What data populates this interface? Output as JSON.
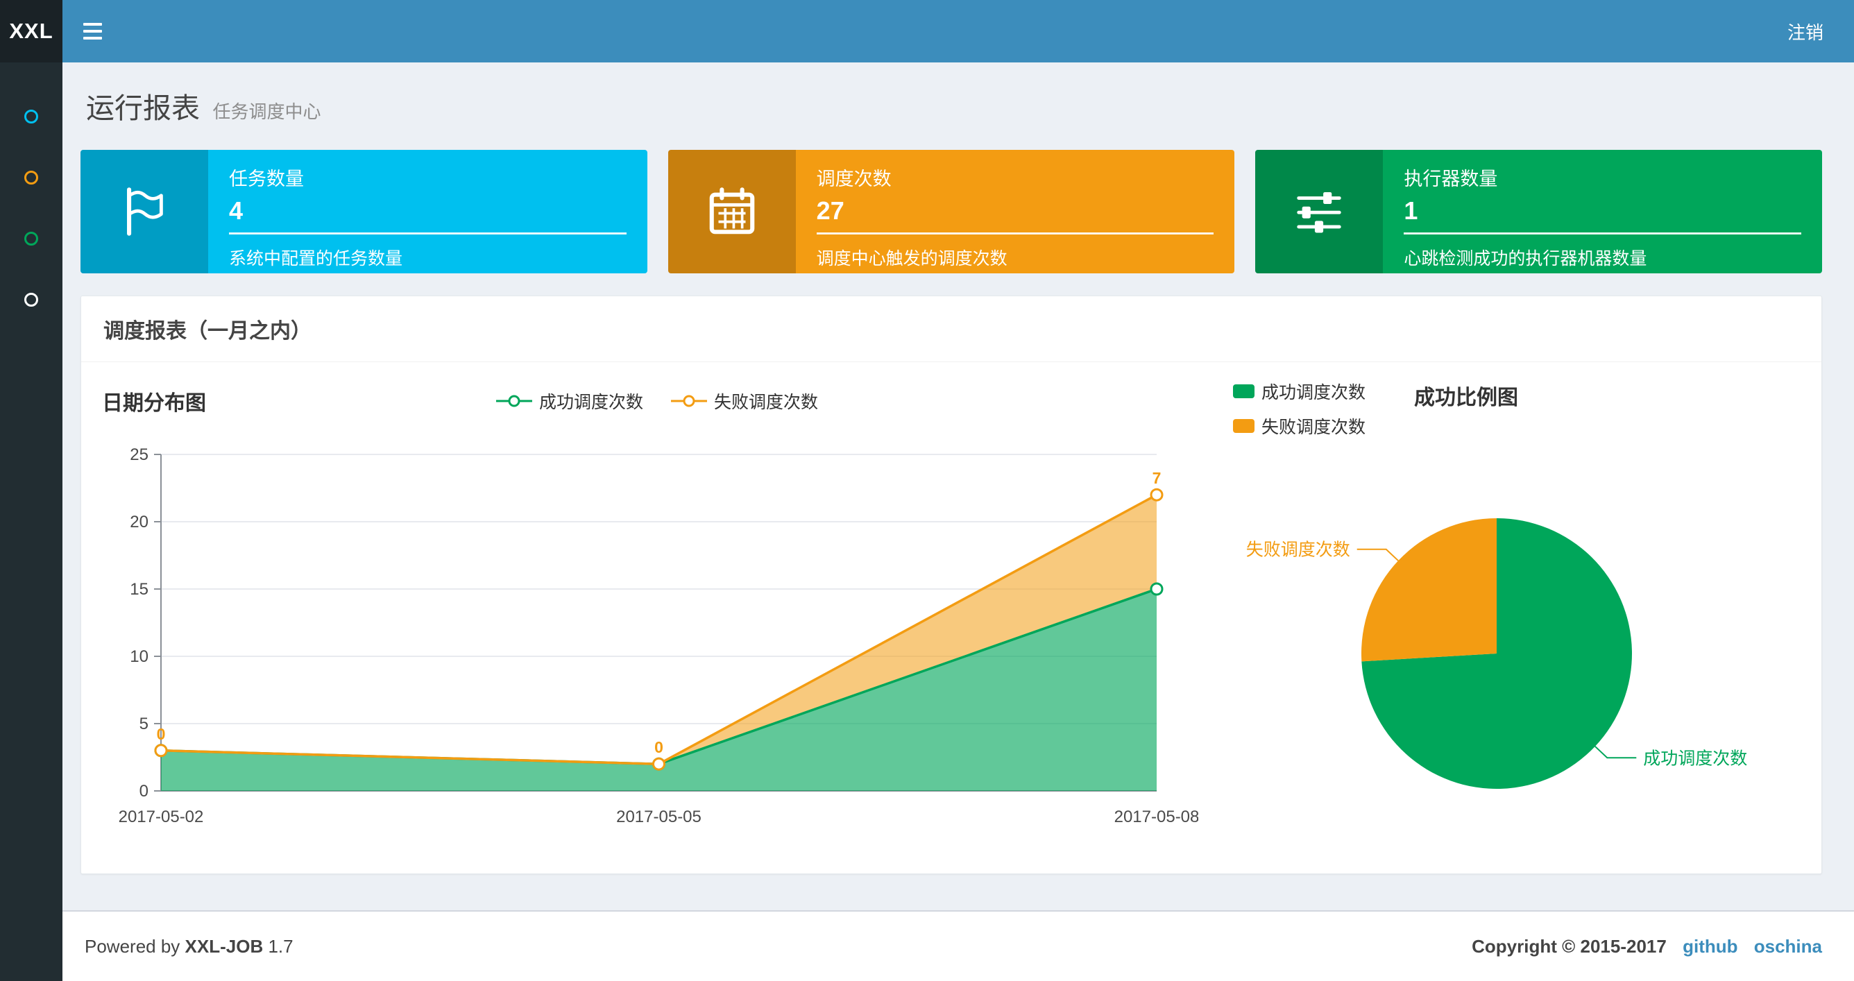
{
  "navbar": {
    "logo": "XXL",
    "logout": "注销"
  },
  "sidebar": {
    "items": [
      {
        "icon": "circle-icon",
        "color": "#00c0ef"
      },
      {
        "icon": "circle-icon",
        "color": "#f39c12"
      },
      {
        "icon": "circle-icon",
        "color": "#00a65a"
      },
      {
        "icon": "circle-icon",
        "color": "#ffffff"
      }
    ]
  },
  "header": {
    "title": "运行报表",
    "subtitle": "任务调度中心"
  },
  "info_boxes": [
    {
      "icon": "flag-icon",
      "title": "任务数量",
      "value": "4",
      "desc": "系统中配置的任务数量",
      "color": "#00c0ef"
    },
    {
      "icon": "calendar-icon",
      "title": "调度次数",
      "value": "27",
      "desc": "调度中心触发的调度次数",
      "color": "#f39c12"
    },
    {
      "icon": "sliders-icon",
      "title": "执行器数量",
      "value": "1",
      "desc": "心跳检测成功的执行器机器数量",
      "color": "#00a65a"
    }
  ],
  "panel": {
    "title": "调度报表（一月之内）"
  },
  "chart_data": [
    {
      "type": "area",
      "title": "日期分布图",
      "categories": [
        "2017-05-02",
        "2017-05-05",
        "2017-05-08"
      ],
      "series": [
        {
          "name": "成功调度次数",
          "values": [
            3,
            2,
            15
          ],
          "color": "#00a65a"
        },
        {
          "name": "失败调度次数",
          "values": [
            0,
            0,
            7
          ],
          "color": "#f39c12",
          "labels": [
            "0",
            "0",
            "7"
          ]
        }
      ],
      "stacked": true,
      "xlabel": "",
      "ylabel": "",
      "ylim": [
        0,
        25
      ],
      "yticks": [
        0,
        5,
        10,
        15,
        20,
        25
      ],
      "grid": true,
      "legend_position": "top"
    },
    {
      "type": "pie",
      "title": "成功比例图",
      "slices": [
        {
          "name": "成功调度次数",
          "value": 20,
          "color": "#00a65a"
        },
        {
          "name": "失败调度次数",
          "value": 7,
          "color": "#f39c12"
        }
      ],
      "legend": [
        "成功调度次数",
        "失败调度次数"
      ],
      "legend_position": "top-left"
    }
  ],
  "footer": {
    "powered": "Powered by",
    "brand": "XXL-JOB",
    "version": "1.7",
    "copyright": "Copyright © 2015-2017",
    "links": [
      "github",
      "oschina"
    ]
  }
}
